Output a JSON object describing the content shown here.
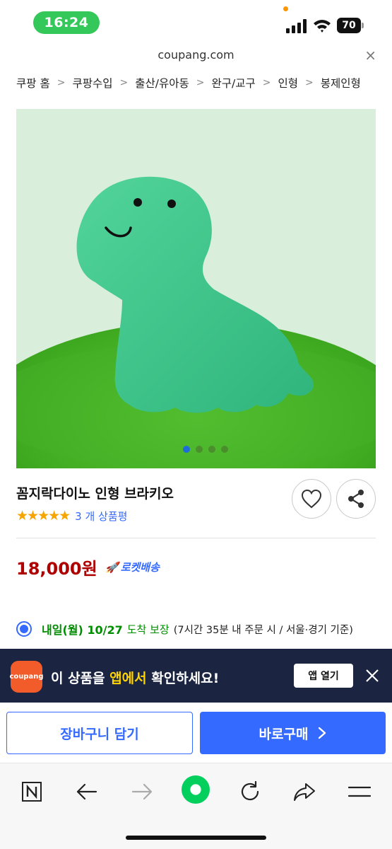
{
  "status_bar": {
    "time": "16:24",
    "battery": "70"
  },
  "browser": {
    "url": "coupang.com"
  },
  "breadcrumb": [
    "쿠팡 홈",
    "쿠팡수입",
    "출산/유아동",
    "완구/교구",
    "인형",
    "봉제인형"
  ],
  "product": {
    "title": "꼼지락다이노 인형 브라키오",
    "stars": "★★★★★",
    "review_count": "3 개 상품평",
    "price": "18,000원",
    "rocket_label": "로켓배송",
    "image_slides": 4,
    "image_active_index": 0
  },
  "delivery": {
    "date": "내일(월) 10/27",
    "arrive": "도착 보장",
    "note": "(7시간 35분 내 주문 시 / 서울·경기 기준)"
  },
  "app_banner": {
    "logo_text": "coupang",
    "text_prefix": "이 상품을 ",
    "text_highlight": "앱에서",
    "text_suffix": " 확인하세요!",
    "open_label": "앱 열기"
  },
  "actions": {
    "cart_label": "장바구니 담기",
    "buy_label": "바로구매"
  },
  "colors": {
    "accent": "#346aff",
    "price": "#ae0000",
    "delivery": "#008c00",
    "banner": "#1b2440",
    "highlight": "#ffd400"
  }
}
